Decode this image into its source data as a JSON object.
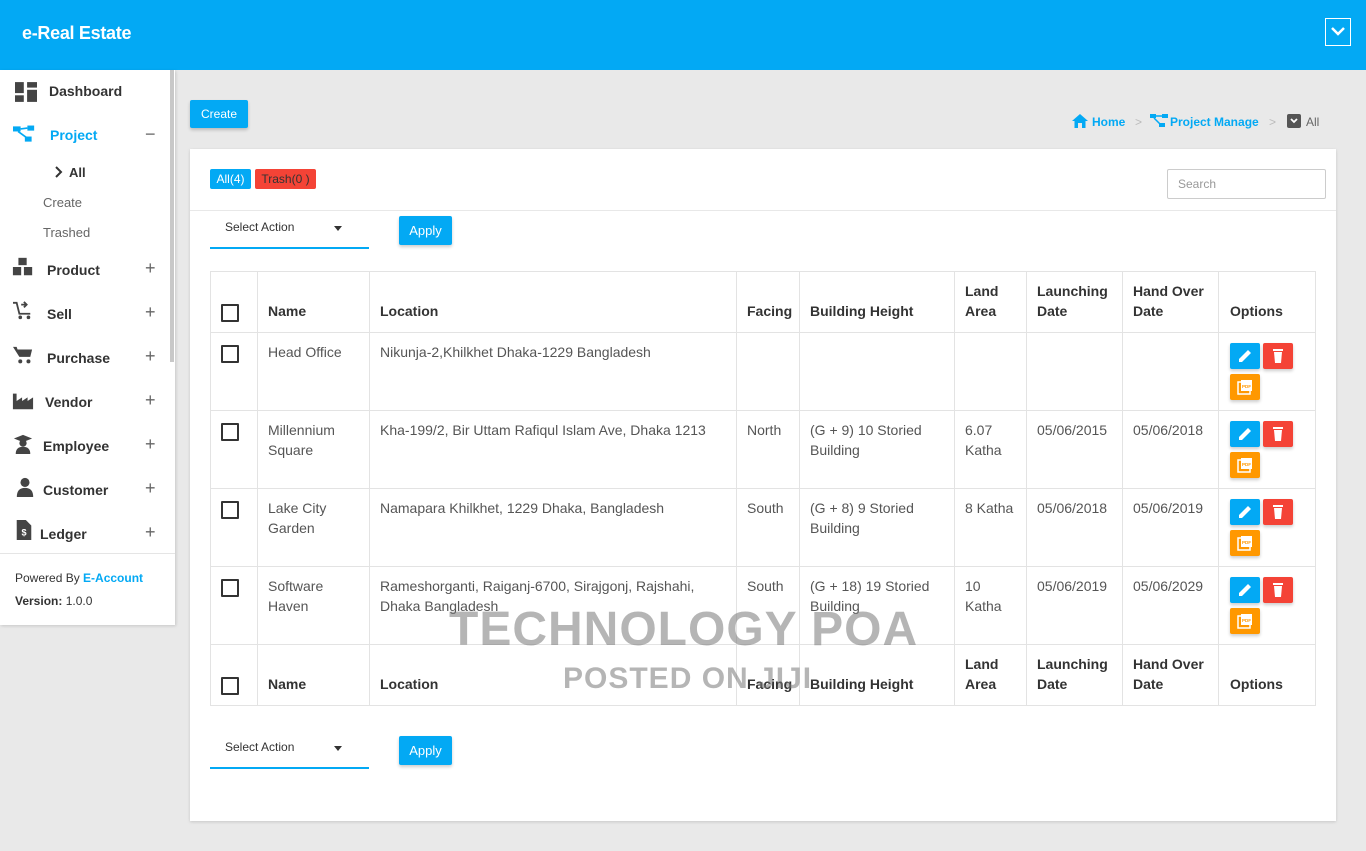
{
  "app": {
    "title": "e-Real Estate"
  },
  "sidebar": {
    "items": [
      {
        "label": "Dashboard",
        "icon": "dashboard-icon",
        "sign": ""
      },
      {
        "label": "Project",
        "icon": "sitemap-icon",
        "sign": "−"
      },
      {
        "label": "Product",
        "icon": "boxes-icon",
        "sign": "+"
      },
      {
        "label": "Sell",
        "icon": "cart-arrow-icon",
        "sign": "+"
      },
      {
        "label": "Purchase",
        "icon": "cart-icon",
        "sign": "+"
      },
      {
        "label": "Vendor",
        "icon": "factory-icon",
        "sign": "+"
      },
      {
        "label": "Employee",
        "icon": "graduate-icon",
        "sign": "+"
      },
      {
        "label": "Customer",
        "icon": "user-icon",
        "sign": "+"
      },
      {
        "label": "Ledger",
        "icon": "invoice-dollar-icon",
        "sign": "+"
      }
    ],
    "project_sub": {
      "all": "All",
      "create": "Create",
      "trashed": "Trashed"
    },
    "footer": {
      "powered_prefix": "Powered By ",
      "powered_name": "E-Account",
      "version_label": "Version:",
      "version_value": " 1.0.0"
    }
  },
  "toolbar": {
    "create_label": "Create"
  },
  "breadcrumb": {
    "home": "Home",
    "sep": ">",
    "section": "Project Manage",
    "current": "All"
  },
  "filters": {
    "all": "All(4)",
    "trash": "Trash(0 )"
  },
  "search": {
    "placeholder": "Search"
  },
  "bulk": {
    "select_label": "Select Action",
    "apply_label": "Apply"
  },
  "table": {
    "headers": {
      "name": "Name",
      "location": "Location",
      "facing": "Facing",
      "building_height": "Building Height",
      "land_area": [
        "Land",
        "Area"
      ],
      "launching_date": [
        "Launching",
        "Date"
      ],
      "hand_over_date": [
        "Hand Over",
        "Date"
      ],
      "options": "Options"
    },
    "rows": [
      {
        "name": [
          "Head Office",
          ""
        ],
        "location": [
          "Nikunja-2,Khilkhet Dhaka-1229 Bangladesh",
          ""
        ],
        "facing": "",
        "building_height": [
          "",
          ""
        ],
        "land_area": [
          "",
          ""
        ],
        "launching_date": "",
        "hand_over_date": ""
      },
      {
        "name": [
          "Millennium",
          "Square"
        ],
        "location": [
          "Kha-199/2, Bir Uttam Rafiqul Islam Ave, Dhaka 1213",
          ""
        ],
        "facing": "North",
        "building_height": [
          "(G + 9) 10 Storied",
          "Building"
        ],
        "land_area": [
          "6.07",
          "Katha"
        ],
        "launching_date": "05/06/2015",
        "hand_over_date": "05/06/2018"
      },
      {
        "name": [
          "Lake City",
          "Garden"
        ],
        "location": [
          "Namapara Khilkhet, 1229 Dhaka, Bangladesh",
          ""
        ],
        "facing": "South",
        "building_height": [
          "(G + 8) 9 Storied",
          "Building"
        ],
        "land_area": [
          "8 Katha",
          ""
        ],
        "launching_date": "05/06/2018",
        "hand_over_date": "05/06/2019"
      },
      {
        "name": [
          "Software",
          "Haven"
        ],
        "location": [
          "Rameshorganti, Raiganj-6700, Sirajgonj, Rajshahi,",
          "Dhaka Bangladesh"
        ],
        "facing": "South",
        "building_height": [
          "(G + 18) 19 Storied",
          "Building"
        ],
        "land_area": [
          "10",
          "Katha"
        ],
        "launching_date": "05/06/2019",
        "hand_over_date": "05/06/2029"
      }
    ]
  },
  "watermark": {
    "line1": "TECHNOLOGY POA",
    "line2": "POSTED ON JIJI"
  },
  "colors": {
    "primary": "#03a9f4",
    "danger": "#f44336",
    "warning": "#ff9800"
  }
}
